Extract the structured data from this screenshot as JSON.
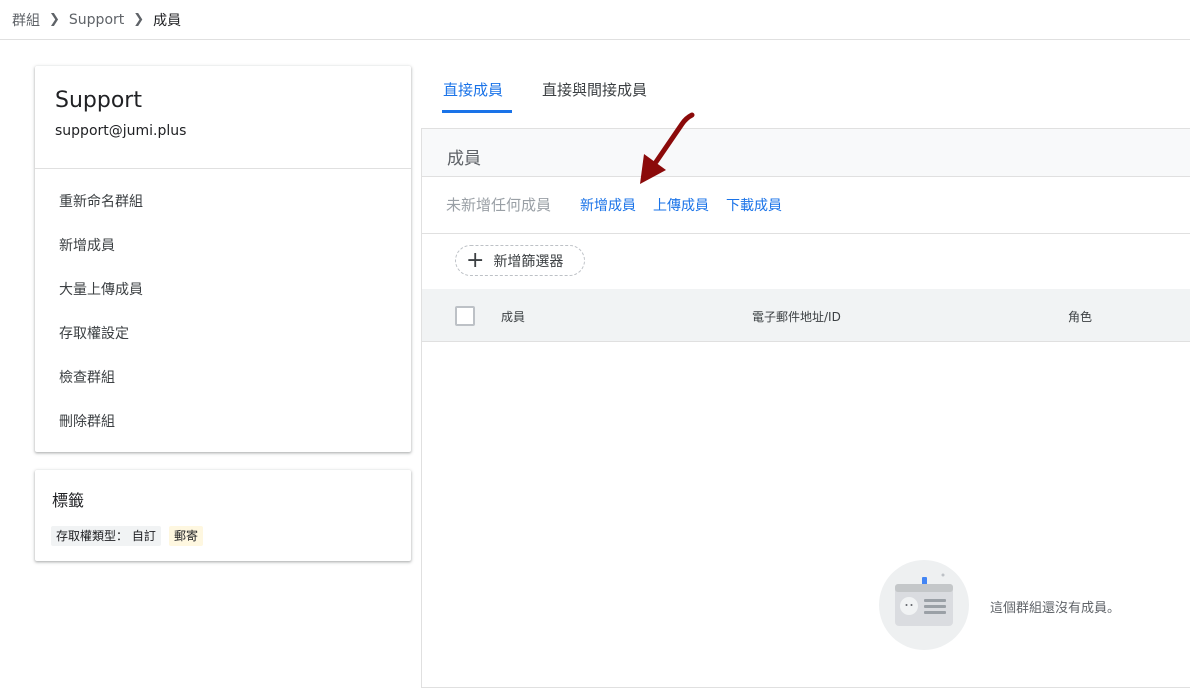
{
  "breadcrumb": {
    "root": "群組",
    "group": "Support",
    "current": "成員"
  },
  "group": {
    "name": "Support",
    "email": "support@jumi.plus"
  },
  "menu": {
    "items": [
      {
        "label": "重新命名群組"
      },
      {
        "label": "新增成員"
      },
      {
        "label": "大量上傳成員"
      },
      {
        "label": "存取權設定"
      },
      {
        "label": "檢查群組"
      },
      {
        "label": "刪除群組"
      }
    ]
  },
  "labels": {
    "title": "標籤",
    "chips": [
      {
        "text": "存取權類型：  自訂"
      },
      {
        "text": "郵寄"
      }
    ]
  },
  "tabs": [
    {
      "label": "直接成員",
      "active": true
    },
    {
      "label": "直接與間接成員",
      "active": false
    }
  ],
  "members_panel": {
    "title": "成員",
    "no_members_text": "未新增任何成員",
    "actions": {
      "add": "新增成員",
      "upload": "上傳成員",
      "download": "下載成員"
    },
    "filter_button": "新增篩選器",
    "columns": {
      "member": "成員",
      "email": "電子郵件地址/ID",
      "role": "角色"
    },
    "empty_message": "這個群組還沒有成員。"
  },
  "colors": {
    "accent": "#1a73e8",
    "annotation_arrow": "#8b0a0a",
    "chip_mail_bg": "#fef7e0"
  },
  "icons": [
    "chevron-right-icon",
    "plus-icon",
    "checkbox-icon",
    "member-card-illustration",
    "annotation-arrow"
  ]
}
